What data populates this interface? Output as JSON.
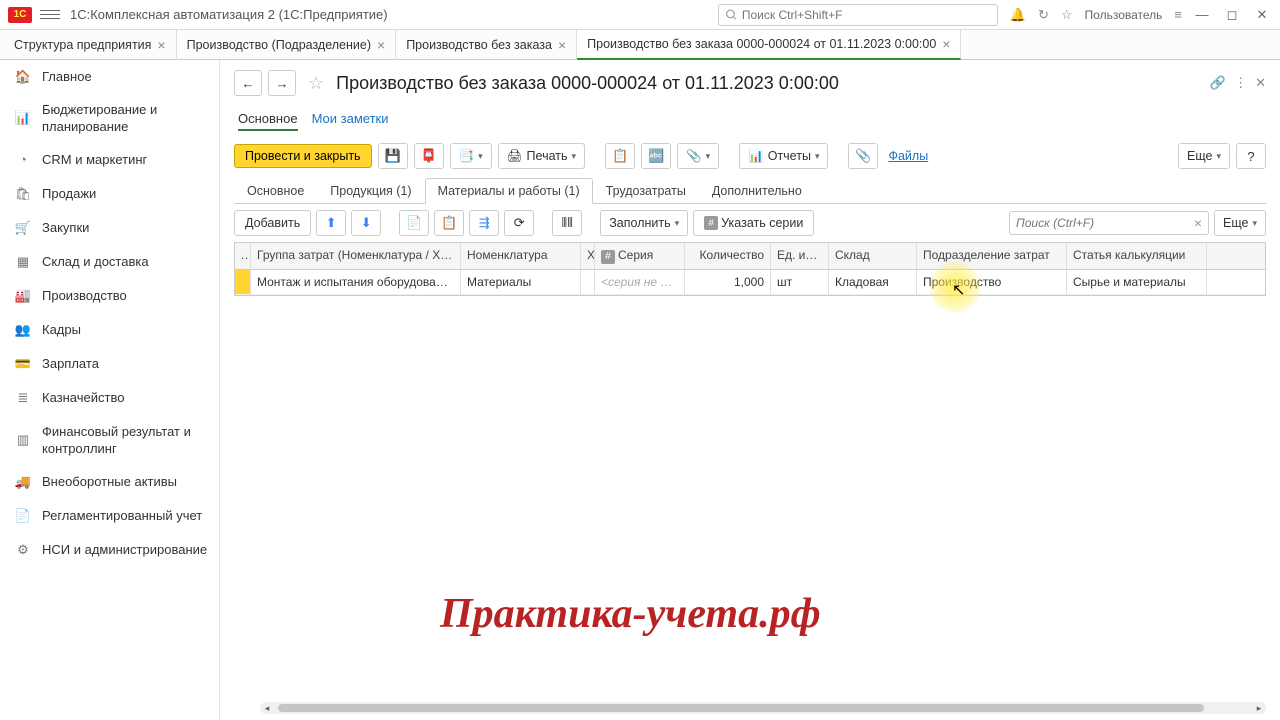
{
  "titlebar": {
    "logo_text": "1C",
    "app_title": "1С:Комплексная автоматизация 2  (1С:Предприятие)",
    "search_placeholder": "Поиск Ctrl+Shift+F",
    "user_label": "Пользователь"
  },
  "tabs": [
    {
      "label": "Структура предприятия",
      "closable": true
    },
    {
      "label": "Производство (Подразделение)",
      "closable": true
    },
    {
      "label": "Производство без заказа",
      "closable": true
    },
    {
      "label": "Производство без заказа 0000-000024 от 01.11.2023 0:00:00",
      "closable": true,
      "active": true
    }
  ],
  "sidebar": [
    {
      "icon": "home",
      "label": "Главное"
    },
    {
      "icon": "chart",
      "label": "Бюджетирование и планирование"
    },
    {
      "icon": "pie",
      "label": "CRM и маркетинг"
    },
    {
      "icon": "bag",
      "label": "Продажи"
    },
    {
      "icon": "cart",
      "label": "Закупки"
    },
    {
      "icon": "boxes",
      "label": "Склад и доставка"
    },
    {
      "icon": "factory",
      "label": "Производство"
    },
    {
      "icon": "people",
      "label": "Кадры"
    },
    {
      "icon": "wallet",
      "label": "Зарплата"
    },
    {
      "icon": "stack",
      "label": "Казначейство"
    },
    {
      "icon": "bars",
      "label": "Финансовый результат и контроллинг"
    },
    {
      "icon": "truck",
      "label": "Внеоборотные активы"
    },
    {
      "icon": "doc",
      "label": "Регламентированный учет"
    },
    {
      "icon": "gear",
      "label": "НСИ и администрирование"
    }
  ],
  "doc": {
    "title": "Производство без заказа 0000-000024 от 01.11.2023 0:00:00",
    "sub_tabs": {
      "main": "Основное",
      "notes": "Мои заметки"
    },
    "toolbar": {
      "post_close": "Провести и закрыть",
      "print": "Печать",
      "reports": "Отчеты",
      "files": "Файлы",
      "more": "Еще"
    },
    "inner_tabs": [
      {
        "label": "Основное"
      },
      {
        "label": "Продукция (1)"
      },
      {
        "label": "Материалы и работы (1)",
        "active": true
      },
      {
        "label": "Трудозатраты"
      },
      {
        "label": "Дополнительно"
      }
    ],
    "table_toolbar": {
      "add": "Добавить",
      "fill": "Заполнить",
      "series": "Указать серии",
      "search_placeholder": "Поиск (Ctrl+F)",
      "more": "Еще"
    },
    "columns": {
      "group": "Группа затрат (Номенклатура / Ха...",
      "nomen": "Номенклатура",
      "char": "Х",
      "series": "Серия",
      "qty": "Количество",
      "unit": "Ед. изм.",
      "wh": "Склад",
      "dept": "Подразделение затрат",
      "cost": "Статья калькуляции"
    },
    "rows": [
      {
        "group": "Монтаж и испытания оборудования",
        "nomen": "Материалы",
        "char": "",
        "series": "<серия не ук...",
        "qty": "1,000",
        "unit": "шт",
        "wh": "Кладовая",
        "dept": "Производство",
        "cost": "Сырье и материалы"
      }
    ]
  },
  "watermark": "Практика-учета.рф"
}
